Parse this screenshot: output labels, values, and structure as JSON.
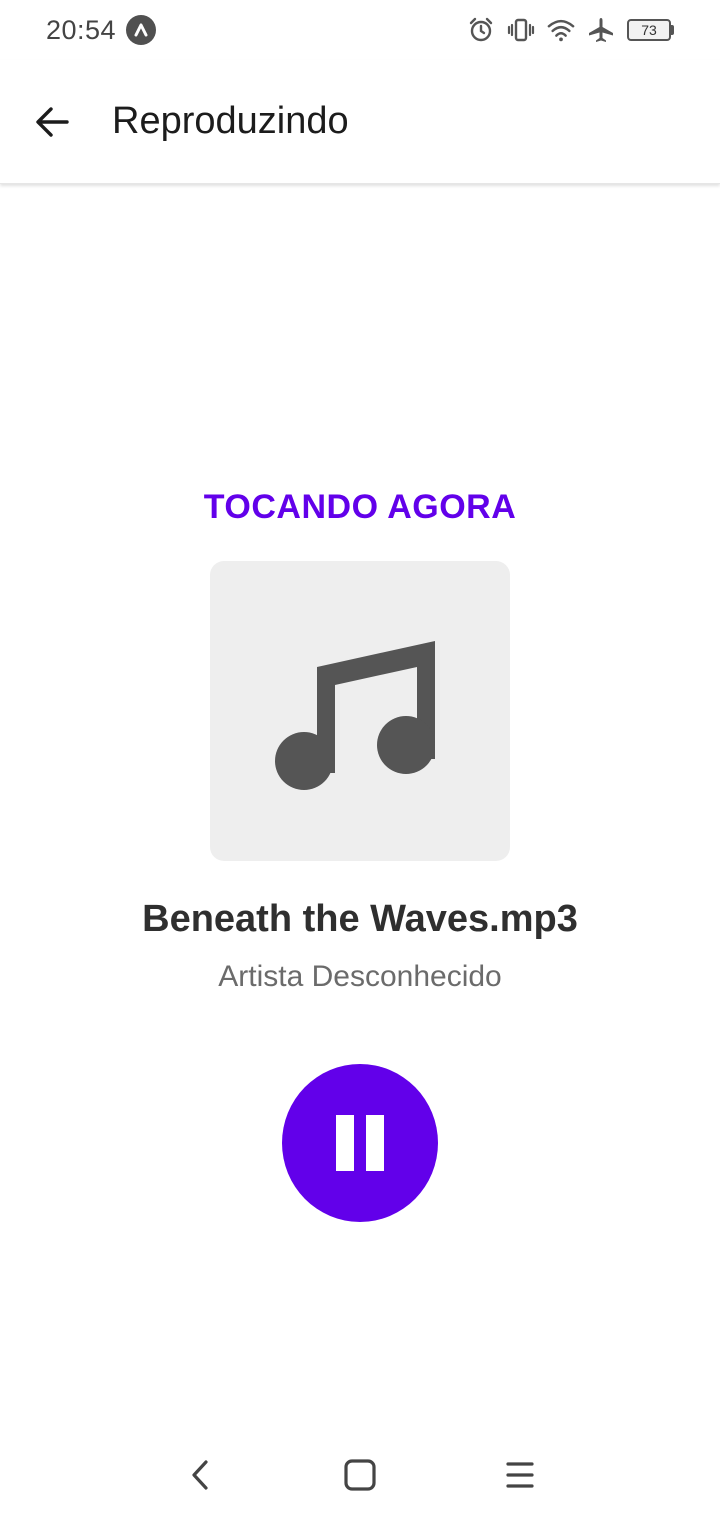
{
  "status_bar": {
    "time": "20:54",
    "battery_level": "73",
    "icons": [
      "app-notification-icon",
      "alarm-icon",
      "vibrate-icon",
      "wifi-icon",
      "airplane-mode-icon",
      "battery-icon"
    ]
  },
  "app_bar": {
    "title": "Reproduzindo",
    "back_icon": "arrow-back-icon"
  },
  "player": {
    "section_label": "TOCANDO AGORA",
    "album_art_icon": "music-note-icon",
    "track_title": "Beneath the Waves.mp3",
    "track_artist": "Artista Desconhecido",
    "state_icon": "pause-icon",
    "accent_color": "#6200ea"
  },
  "nav_bar": {
    "icons": [
      "nav-back-icon",
      "nav-home-icon",
      "nav-menu-icon"
    ]
  }
}
